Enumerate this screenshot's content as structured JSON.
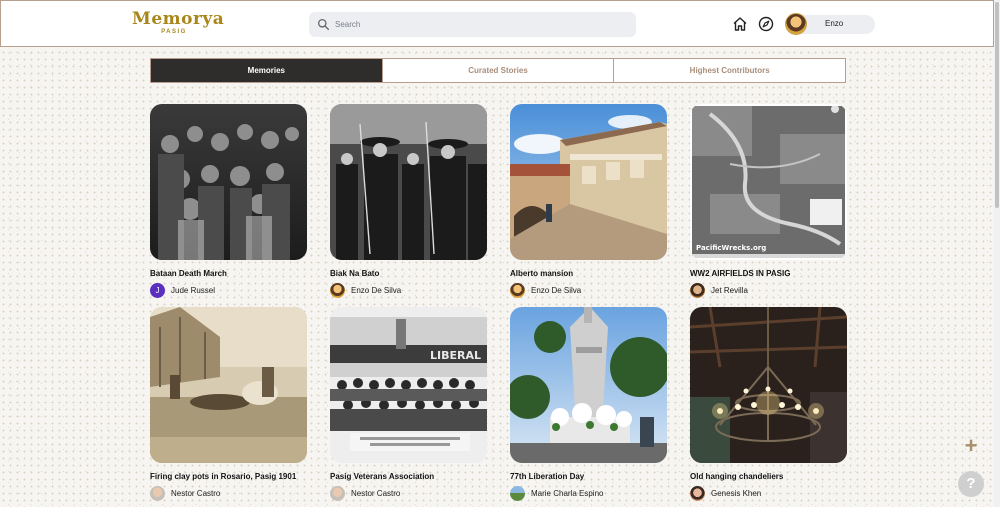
{
  "brand": {
    "name": "Memorya",
    "subtitle": "PASIG",
    "color": "#a8861a"
  },
  "search": {
    "placeholder": "Search"
  },
  "header": {
    "icons": [
      "home-icon",
      "compass-icon"
    ],
    "user": {
      "name": "Enzo"
    }
  },
  "tabs": [
    {
      "label": "Memories",
      "active": true
    },
    {
      "label": "Curated Stories",
      "active": false
    },
    {
      "label": "Highest Contributors",
      "active": false
    }
  ],
  "memories": [
    {
      "title": "Bataan Death March",
      "author": "Jude Russel",
      "avatar_letter": "J"
    },
    {
      "title": "Biak Na Bato",
      "author": "Enzo De Silva"
    },
    {
      "title": "Alberto mansion",
      "author": "Enzo De Silva"
    },
    {
      "title": "WW2 AIRFIELDS IN PASIG",
      "author": "Jet Revilla",
      "image_caption": "PacificWrecks.org"
    },
    {
      "title": "Firing clay pots in Rosario, Pasig 1901",
      "author": "Nestor Castro"
    },
    {
      "title": "Pasig Veterans Association",
      "author": "Nestor Castro",
      "image_caption": "LIBERAL"
    },
    {
      "title": "77th Liberation Day",
      "author": "Marie Charla Espino"
    },
    {
      "title": "Old hanging chandeliers",
      "author": "Genesis Khen"
    }
  ],
  "fabs": {
    "add_label": "+",
    "help_label": "?"
  },
  "colors": {
    "accent": "#a8861a",
    "tab_active_bg": "#2f2d2b",
    "tab_border": "#b89f8d",
    "tab_text": "#a98e7a"
  }
}
